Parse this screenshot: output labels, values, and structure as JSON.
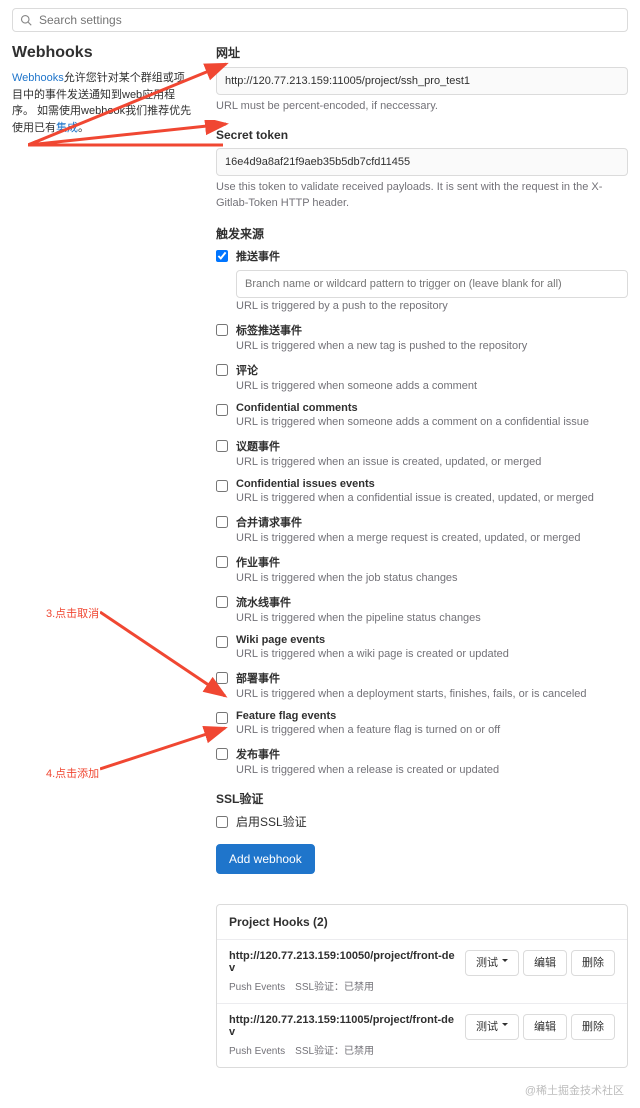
{
  "search": {
    "placeholder": "Search settings"
  },
  "sidebar": {
    "title": "Webhooks",
    "link1": "Webhooks",
    "desc1": "允许您针对某个群组或项目中的事件发送通知到web应用程序。 如需使用webhook我们推荐优先使用已有",
    "link2": "集成",
    "desc2": "。"
  },
  "url_section": {
    "label": "网址",
    "value": "http://120.77.213.159:11005/project/ssh_pro_test1",
    "help": "URL must be percent-encoded, if neccessary."
  },
  "token_section": {
    "label": "Secret token",
    "value": "16e4d9a8af21f9aeb35b5db7cfd11455",
    "help": "Use this token to validate received payloads. It is sent with the request in the X-Gitlab-Token HTTP header."
  },
  "triggers": {
    "label": "触发来源",
    "branch_placeholder": "Branch name or wildcard pattern to trigger on (leave blank for all)",
    "items": [
      {
        "checked": true,
        "title": "推送事件",
        "desc": "URL is triggered by a push to the repository",
        "has_branch": true
      },
      {
        "checked": false,
        "title": "标签推送事件",
        "desc": "URL is triggered when a new tag is pushed to the repository"
      },
      {
        "checked": false,
        "title": "评论",
        "desc": "URL is triggered when someone adds a comment"
      },
      {
        "checked": false,
        "title": "Confidential comments",
        "desc": "URL is triggered when someone adds a comment on a confidential issue"
      },
      {
        "checked": false,
        "title": "议题事件",
        "desc": "URL is triggered when an issue is created, updated, or merged"
      },
      {
        "checked": false,
        "title": "Confidential issues events",
        "desc": "URL is triggered when a confidential issue is created, updated, or merged"
      },
      {
        "checked": false,
        "title": "合并请求事件",
        "desc": "URL is triggered when a merge request is created, updated, or merged"
      },
      {
        "checked": false,
        "title": "作业事件",
        "desc": "URL is triggered when the job status changes"
      },
      {
        "checked": false,
        "title": "流水线事件",
        "desc": "URL is triggered when the pipeline status changes"
      },
      {
        "checked": false,
        "title": "Wiki page events",
        "desc": "URL is triggered when a wiki page is created or updated"
      },
      {
        "checked": false,
        "title": "部署事件",
        "desc": "URL is triggered when a deployment starts, finishes, fails, or is canceled"
      },
      {
        "checked": false,
        "title": "Feature flag events",
        "desc": "URL is triggered when a feature flag is turned on or off"
      },
      {
        "checked": false,
        "title": "发布事件",
        "desc": "URL is triggered when a release is created or updated"
      }
    ]
  },
  "ssl": {
    "label": "SSL验证",
    "checkbox": "启用SSL验证"
  },
  "add_button": "Add webhook",
  "hooks": {
    "header": "Project Hooks (2)",
    "test_label": "测试",
    "edit_label": "编辑",
    "delete_label": "删除",
    "items": [
      {
        "url": "http://120.77.213.159:10050/project/front-dev",
        "events": "Push Events",
        "ssl": "SSL验证：已禁用"
      },
      {
        "url": "http://120.77.213.159:11005/project/front-dev",
        "events": "Push Events",
        "ssl": "SSL验证：已禁用"
      }
    ]
  },
  "annotations": {
    "cancel": "3.点击取消",
    "add": "4.点击添加"
  },
  "watermark": "@稀土掘金技术社区"
}
